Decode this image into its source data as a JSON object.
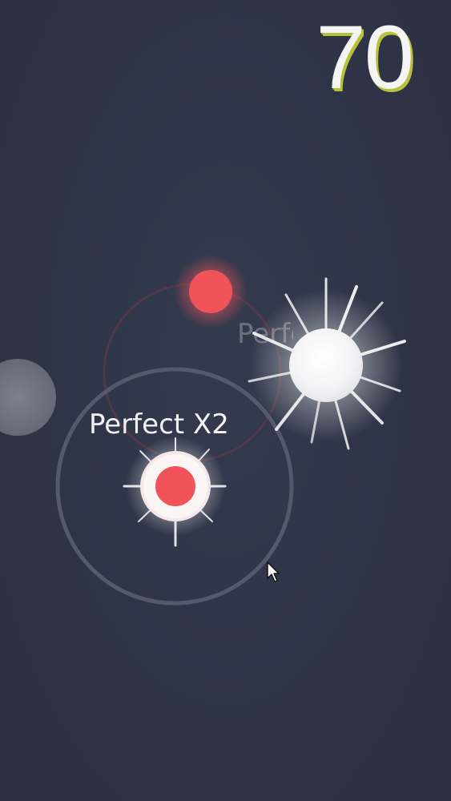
{
  "game": {
    "score": "70",
    "hit_label": "Perfect X2",
    "ghost_label": "Perfect"
  },
  "colors": {
    "background": "#2f3547",
    "ball_red": "#f0545a",
    "ball_white": "#ffffff",
    "score_shadow": "#b7c23a",
    "orbit_ring": "#5a6072"
  },
  "icons": {
    "cursor": "mouse-pointer-icon"
  }
}
